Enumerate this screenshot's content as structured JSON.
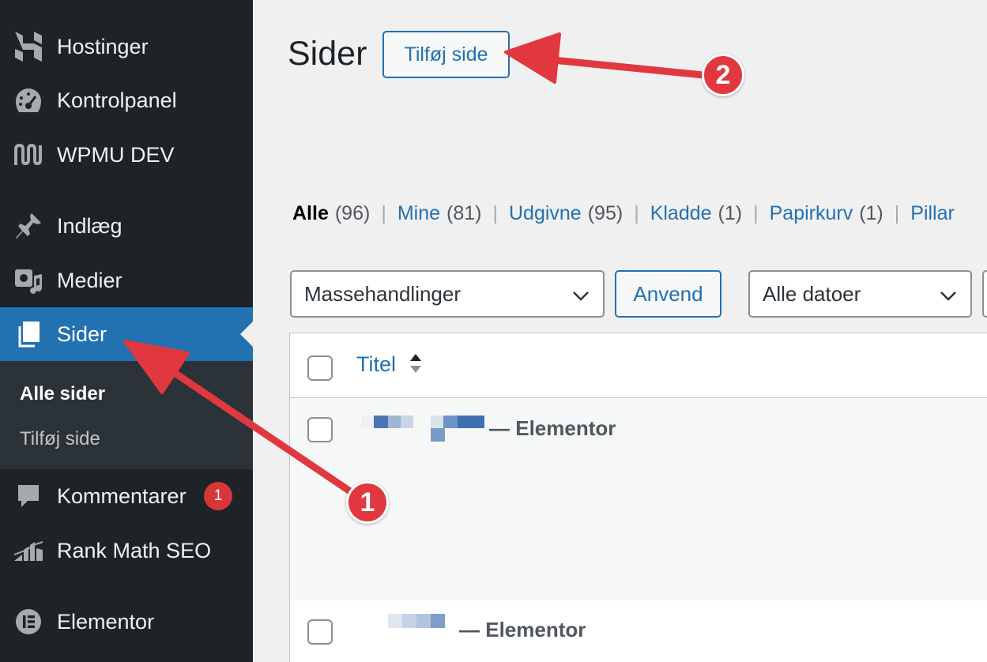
{
  "sidebar": {
    "items": [
      {
        "label": "Hostinger",
        "icon": "hostinger-logo-icon"
      },
      {
        "label": "Kontrolpanel",
        "icon": "dashboard-gauge-icon"
      },
      {
        "label": "WPMU DEV",
        "icon": "wpmudev-logo-icon"
      },
      {
        "label": "Indlæg",
        "icon": "pushpin-icon"
      },
      {
        "label": "Medier",
        "icon": "media-icon"
      },
      {
        "label": "Sider",
        "icon": "pages-icon",
        "active": true
      },
      {
        "label": "Kommentarer",
        "icon": "comment-bubble-icon",
        "badge": "1"
      },
      {
        "label": "Rank Math SEO",
        "icon": "rankmath-chart-icon"
      },
      {
        "label": "Elementor",
        "icon": "elementor-logo-icon"
      }
    ],
    "submenu": [
      {
        "label": "Alle sider",
        "current": true
      },
      {
        "label": "Tilføj side"
      }
    ]
  },
  "main": {
    "title": "Sider",
    "add_button": "Tilføj side",
    "filters": [
      {
        "label": "Alle",
        "count": "(96)",
        "current": true
      },
      {
        "label": "Mine",
        "count": "(81)"
      },
      {
        "label": "Udgivne",
        "count": "(95)"
      },
      {
        "label": "Kladde",
        "count": "(1)"
      },
      {
        "label": "Papirkurv",
        "count": "(1)"
      },
      {
        "label": "Pillar",
        "count": ""
      }
    ],
    "separator": "|",
    "bulk_select": "Massehandlinger",
    "apply_button": "Anvend",
    "date_select": "Alle datoer",
    "table": {
      "column_title": "Titel",
      "rows": [
        {
          "suffix": "— Elementor"
        },
        {
          "suffix": "— Elementor"
        }
      ]
    }
  },
  "annotations": {
    "markers": [
      "1",
      "2"
    ],
    "color": "#e0383e"
  },
  "colors": {
    "sidebar_bg": "#1d2327",
    "accent": "#2271b1",
    "badge": "#d63638"
  }
}
